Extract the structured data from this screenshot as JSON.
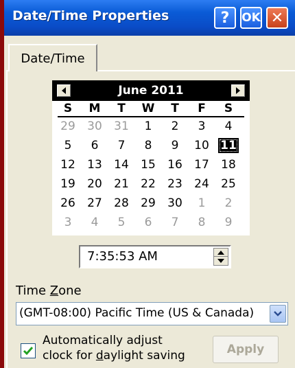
{
  "window": {
    "title": "Date/Time Properties",
    "help_label": "?",
    "ok_label": "OK",
    "close_label": "✕"
  },
  "tabs": [
    {
      "label": "Date/Time",
      "active": true
    }
  ],
  "calendar": {
    "month_year": "June 2011",
    "weekdays": [
      "S",
      "M",
      "T",
      "W",
      "T",
      "F",
      "S"
    ],
    "weeks": [
      [
        {
          "d": "29",
          "dim": true
        },
        {
          "d": "30",
          "dim": true
        },
        {
          "d": "31",
          "dim": true
        },
        {
          "d": "1"
        },
        {
          "d": "2"
        },
        {
          "d": "3"
        },
        {
          "d": "4"
        }
      ],
      [
        {
          "d": "5"
        },
        {
          "d": "6"
        },
        {
          "d": "7"
        },
        {
          "d": "8"
        },
        {
          "d": "9"
        },
        {
          "d": "10"
        },
        {
          "d": "11",
          "selected": true
        }
      ],
      [
        {
          "d": "12"
        },
        {
          "d": "13"
        },
        {
          "d": "14"
        },
        {
          "d": "15"
        },
        {
          "d": "16"
        },
        {
          "d": "17"
        },
        {
          "d": "18"
        }
      ],
      [
        {
          "d": "19"
        },
        {
          "d": "20"
        },
        {
          "d": "21"
        },
        {
          "d": "22"
        },
        {
          "d": "23"
        },
        {
          "d": "24"
        },
        {
          "d": "25"
        }
      ],
      [
        {
          "d": "26"
        },
        {
          "d": "27"
        },
        {
          "d": "28"
        },
        {
          "d": "29"
        },
        {
          "d": "30"
        },
        {
          "d": "1",
          "dim": true
        },
        {
          "d": "2",
          "dim": true
        }
      ],
      [
        {
          "d": "3",
          "dim": true
        },
        {
          "d": "4",
          "dim": true
        },
        {
          "d": "5",
          "dim": true
        },
        {
          "d": "6",
          "dim": true
        },
        {
          "d": "7",
          "dim": true
        },
        {
          "d": "8",
          "dim": true
        },
        {
          "d": "9",
          "dim": true
        }
      ]
    ]
  },
  "time": {
    "value": "7:35:53 AM"
  },
  "timezone": {
    "label_prefix": "Time ",
    "label_accel": "Z",
    "label_rest": "one",
    "selected": "(GMT-08:00) Pacific Time (US & Canada)"
  },
  "dst": {
    "checked": true,
    "line1": "Automatically adjust",
    "line2_prefix": "clock for ",
    "line2_accel": "d",
    "line2_rest": "aylight saving"
  },
  "apply": {
    "label": "Apply",
    "enabled": false
  },
  "colors": {
    "title_bar": "#0a4cc7",
    "close_button": "#c8421b",
    "selected_day_bg": "#000000",
    "check_mark": "#21a121"
  }
}
